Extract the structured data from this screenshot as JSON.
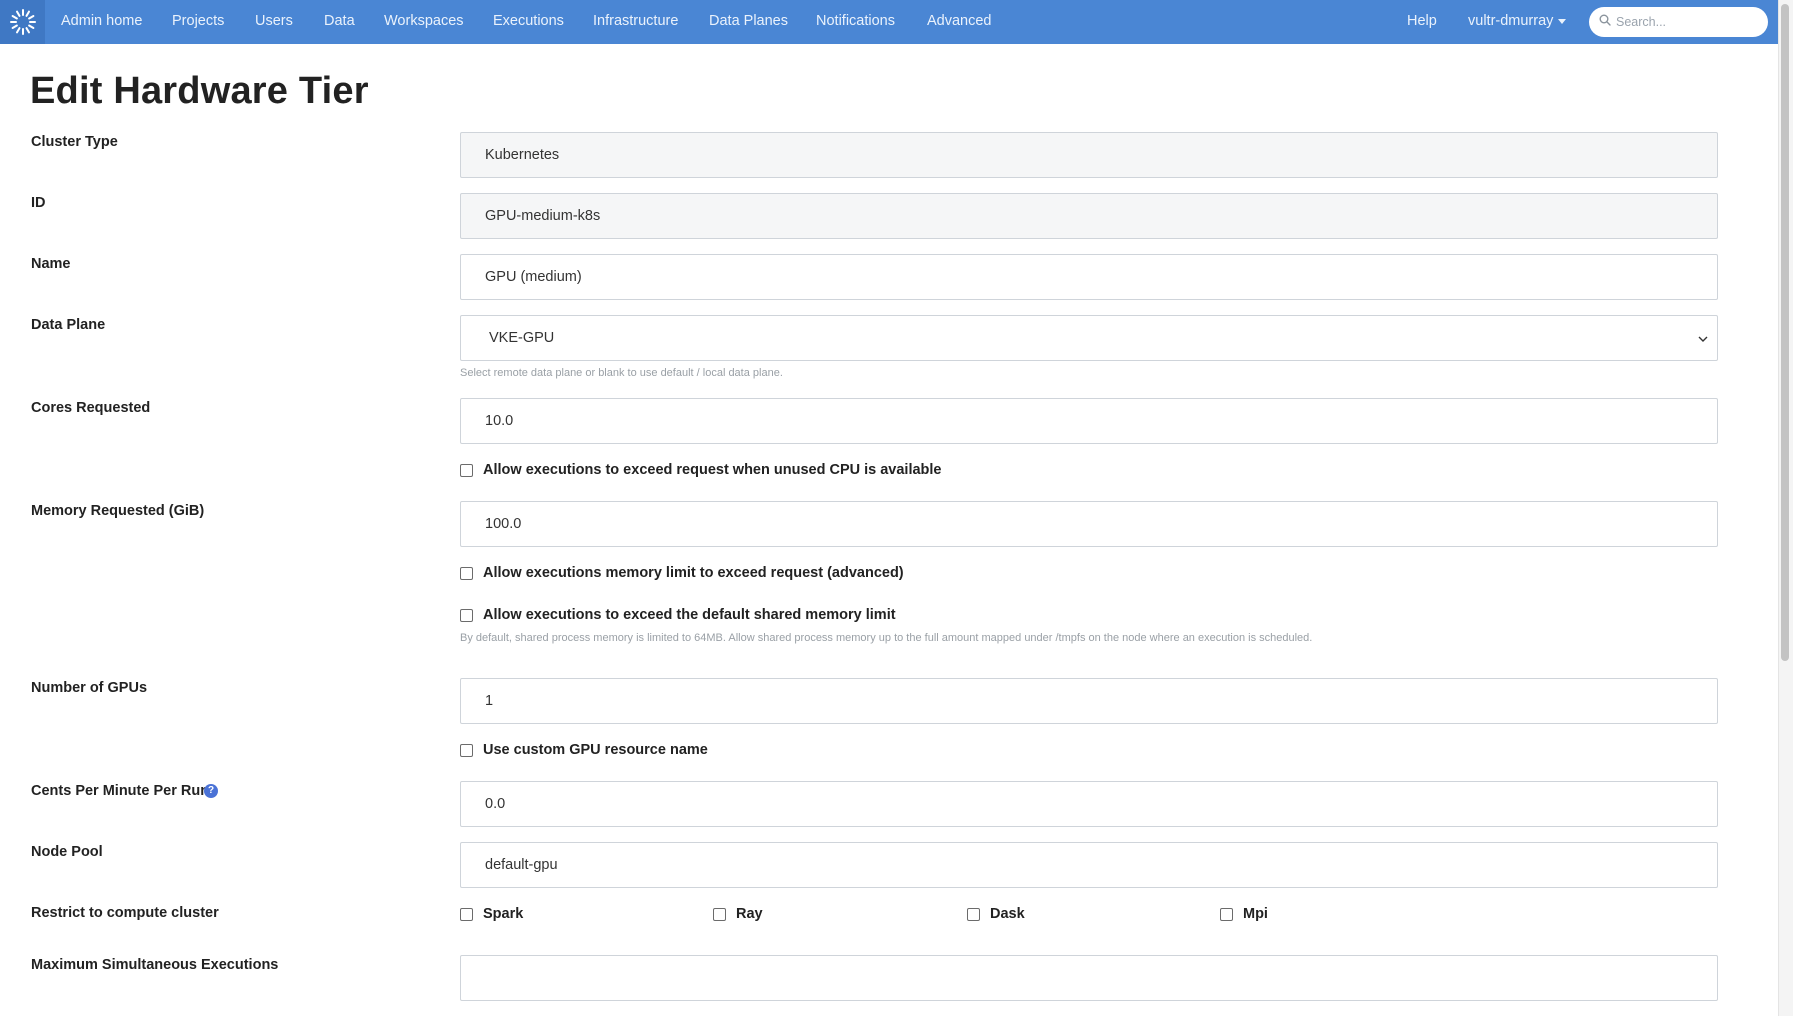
{
  "nav": {
    "items": [
      "Admin home",
      "Projects",
      "Users",
      "Data",
      "Workspaces",
      "Executions",
      "Infrastructure",
      "Data Planes",
      "Notifications",
      "Advanced"
    ],
    "help": "Help",
    "user": "vultr-dmurray",
    "search_placeholder": "Search..."
  },
  "page": {
    "title": "Edit Hardware Tier"
  },
  "form": {
    "cluster_type": {
      "label": "Cluster Type",
      "value": "Kubernetes"
    },
    "id": {
      "label": "ID",
      "value": "GPU-medium-k8s"
    },
    "name": {
      "label": "Name",
      "value": "GPU (medium)"
    },
    "data_plane": {
      "label": "Data Plane",
      "value": "VKE-GPU",
      "help": "Select remote data plane or blank to use default / local data plane."
    },
    "cores_requested": {
      "label": "Cores Requested",
      "value": "10.0",
      "allow_exceed_cpu": "Allow executions to exceed request when unused CPU is available"
    },
    "memory_requested": {
      "label": "Memory Requested (GiB)",
      "value": "100.0",
      "allow_memory_exceed": "Allow executions memory limit to exceed request (advanced)",
      "allow_shared_memory": "Allow executions to exceed the default shared memory limit",
      "shared_memory_help": "By default, shared process memory is limited to 64MB. Allow shared process memory up to the full amount mapped under /tmpfs on the node where an execution is scheduled."
    },
    "gpus": {
      "label": "Number of GPUs",
      "value": "1",
      "custom_resource": "Use custom GPU resource name"
    },
    "cents_per_minute": {
      "label": "Cents Per Minute Per Run",
      "value": "0.0",
      "help_icon": "?"
    },
    "node_pool": {
      "label": "Node Pool",
      "value": "default-gpu"
    },
    "restrict_cluster": {
      "label": "Restrict to compute cluster",
      "options": [
        "Spark",
        "Ray",
        "Dask",
        "Mpi"
      ]
    },
    "max_executions": {
      "label": "Maximum Simultaneous Executions",
      "value": ""
    }
  },
  "colors": {
    "nav_bg": "#4a86d4",
    "accent": "#4a72d6"
  }
}
